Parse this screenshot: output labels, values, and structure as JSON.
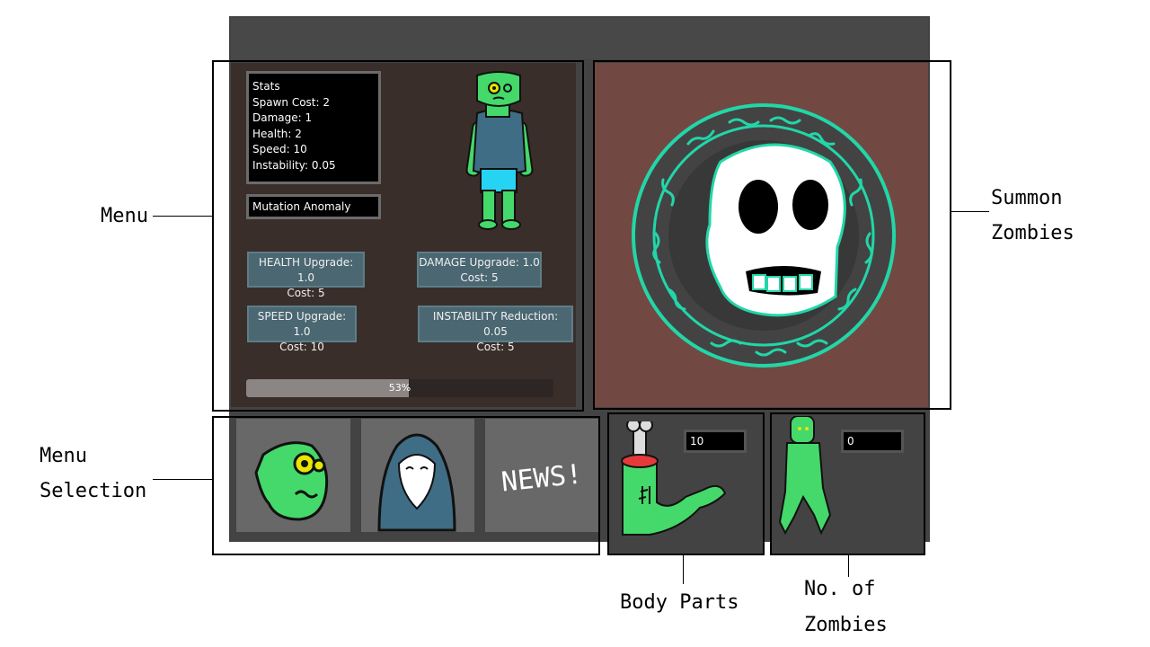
{
  "stats": {
    "title": "Stats",
    "spawn_cost": "Spawn Cost: 2",
    "damage": "Damage: 1",
    "health": "Health: 2",
    "speed": "Speed: 10",
    "instability": "Instability: 0.05"
  },
  "mutation": "Mutation Anomaly",
  "upgrades": [
    {
      "label": "HEALTH Upgrade: 1.0",
      "cost": "Cost: 5"
    },
    {
      "label": "DAMAGE Upgrade: 1.0",
      "cost": "Cost: 5"
    },
    {
      "label": "SPEED Upgrade: 1.0",
      "cost": "Cost: 10"
    },
    {
      "label": "INSTABILITY Reduction: 0.05",
      "cost": "Cost: 5"
    }
  ],
  "progress": {
    "value": 0.53,
    "label": "53%"
  },
  "news_label": "NEWS!",
  "body_parts_count": "10",
  "zombies_count": "0",
  "annotations": {
    "menu": "Menu",
    "summon_line1": "Summon",
    "summon_line2": "Zombies",
    "menu_selection_line1": "Menu",
    "menu_selection_line2": "Selection",
    "body_parts": "Body Parts",
    "zombies_line1": "No. of",
    "zombies_line2": "Zombies"
  },
  "colors": {
    "zombie_green": "#44d96a",
    "summon_bg": "#724942",
    "rune_cyan": "#22d6a8",
    "upgrade_btn": "#4a6772"
  }
}
